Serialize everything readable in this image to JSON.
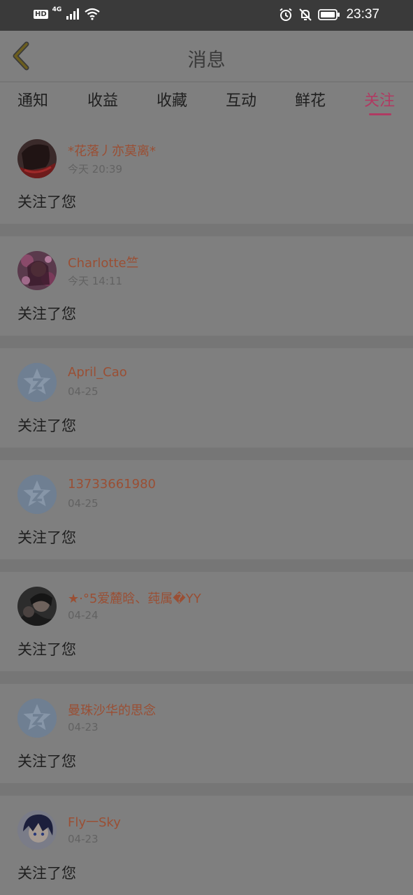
{
  "status_bar": {
    "hd": "HD",
    "network": "4G",
    "time": "23:37"
  },
  "nav": {
    "title": "消息",
    "back_icon": "chevron-left-icon",
    "accent": "#6b5d1e"
  },
  "tabs": [
    {
      "label": "通知",
      "active": false
    },
    {
      "label": "收益",
      "active": false
    },
    {
      "label": "收藏",
      "active": false
    },
    {
      "label": "互动",
      "active": false
    },
    {
      "label": "鲜花",
      "active": false
    },
    {
      "label": "关注",
      "active": true
    }
  ],
  "colors": {
    "active_tab": "#b03a62",
    "username": "#9a4f34"
  },
  "messages": [
    {
      "name": "*花落丿亦莫离*",
      "date": "今天 20:39",
      "text": "关注了您",
      "avatar": "photo-dark-red"
    },
    {
      "name": "Charlotte竺",
      "date": "今天 14:11",
      "text": "关注了您",
      "avatar": "photo-floral-pink"
    },
    {
      "name": "April_Cao",
      "date": "04-25",
      "text": "关注了您",
      "avatar": "default-star-avatar"
    },
    {
      "name": "13733661980",
      "date": "04-25",
      "text": "关注了您",
      "avatar": "default-star-avatar"
    },
    {
      "name": "★·°5爱麓晗、莼属�YY",
      "date": "04-24",
      "text": "关注了您",
      "avatar": "photo-dark-portrait"
    },
    {
      "name": "曼珠沙华的思念",
      "date": "04-23",
      "text": "关注了您",
      "avatar": "default-star-avatar"
    },
    {
      "name": "Fly一Sky",
      "date": "04-23",
      "text": "关注了您",
      "avatar": "photo-anime-boy"
    }
  ]
}
